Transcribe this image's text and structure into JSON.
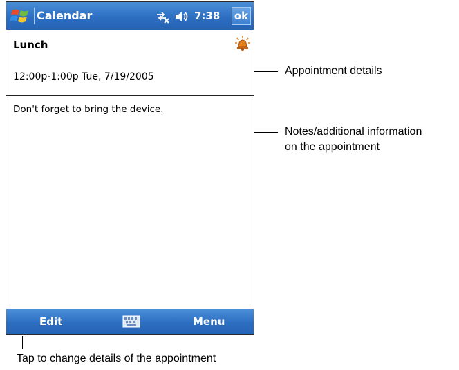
{
  "titlebar": {
    "app_title": "Calendar",
    "time": "7:38",
    "ok_label": "ok",
    "start_icon": "windows-flag-icon",
    "connectivity_icon": "connectivity-icon",
    "volume_icon": "speaker-icon"
  },
  "appointment": {
    "subject": "Lunch",
    "when": "12:00p-1:00p Tue, 7/19/2005",
    "notes": "Don't forget to bring the device.",
    "reminder_icon": "alarm-bell-icon"
  },
  "bottombar": {
    "edit_label": "Edit",
    "menu_label": "Menu",
    "keyboard_icon": "keyboard-icon"
  },
  "callouts": {
    "details": "Appointment details",
    "notes_line1": "Notes/additional information",
    "notes_line2": "on the appointment",
    "edit_hint": "Tap to change details of the appointment"
  },
  "colors": {
    "bar_blue": "#2d6ec1",
    "alarm_orange": "#e8801a"
  }
}
